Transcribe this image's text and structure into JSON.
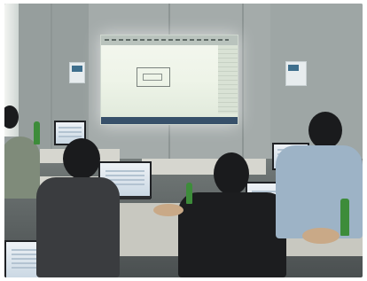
{
  "scene": {
    "description_colors": {
      "wall": "#a4abaa",
      "projection": "#eef4e8",
      "shirt_blue": "#9db3c6",
      "shirt_dark": "#2b2d30",
      "bottle_green": "#3d8c3a"
    }
  }
}
